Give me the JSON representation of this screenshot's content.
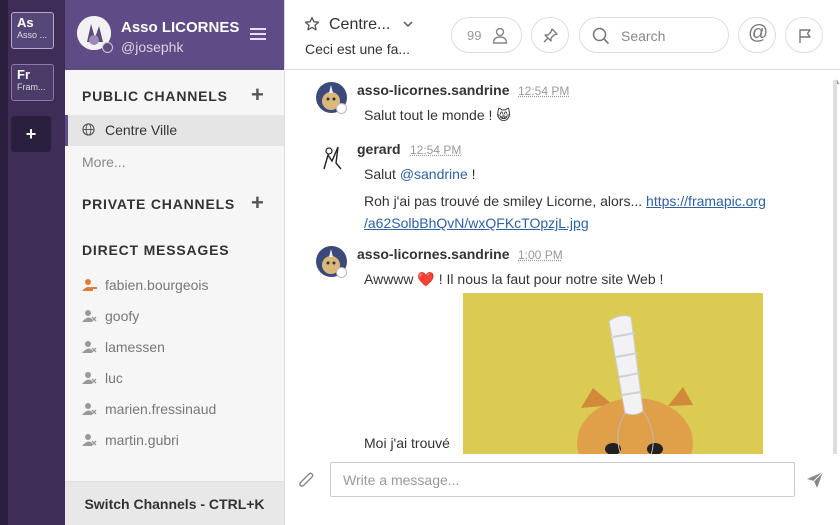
{
  "teams": [
    {
      "abbr": "As",
      "name": "Asso LICORNES",
      "sub": "Asso ..."
    },
    {
      "abbr": "Fr",
      "name": "Framasoft",
      "sub": "Fram..."
    }
  ],
  "add_team": "+",
  "sidebar": {
    "team_name": "Asso LICORNES",
    "username": "@josephk",
    "public_channels_title": "PUBLIC CHANNELS",
    "private_channels_title": "PRIVATE CHANNELS",
    "direct_messages_title": "DIRECT MESSAGES",
    "add_symbol": "+",
    "public_channels": [
      {
        "name": "Centre Ville",
        "active": true
      }
    ],
    "more_label": "More...",
    "direct_messages": [
      {
        "name": "fabien.bourgeois",
        "status": "away"
      },
      {
        "name": "goofy",
        "status": "offline"
      },
      {
        "name": "lamessen",
        "status": "offline"
      },
      {
        "name": "luc",
        "status": "offline"
      },
      {
        "name": "marien.fressinaud",
        "status": "offline"
      },
      {
        "name": "martin.gubri",
        "status": "offline"
      }
    ],
    "switch_channels": "Switch Channels - CTRL+K"
  },
  "header": {
    "channel_name": "Centre...",
    "purpose": "Ceci est une fa...",
    "member_count": "99",
    "search_placeholder": "Search",
    "mention_symbol": "@"
  },
  "posts": [
    {
      "author": "asso-licornes.sandrine",
      "time": "12:54 PM",
      "lines": [
        {
          "text": "Salut tout le monde ! 😸"
        }
      ]
    },
    {
      "author": "gerard",
      "time": "12:54 PM",
      "lines": [
        {
          "pre": "Salut ",
          "mention": "@sandrine",
          "post": " !"
        },
        {
          "pre": "Roh j'ai pas trouvé de smiley Licorne, alors... ",
          "link": "https://framapic.org"
        },
        {
          "link": "/a62SolbBhQvN/wxQFKcTOpzjL.jpg"
        }
      ]
    },
    {
      "author": "asso-licornes.sandrine",
      "time": "1:00 PM",
      "lines": [
        {
          "text": "Awwww ❤️ ! Il nous la faut pour notre site Web !"
        },
        {
          "text": "Moi j'ai trouvé"
        }
      ]
    }
  ],
  "composer": {
    "placeholder": "Write a message..."
  },
  "colors": {
    "sidebar_header": "#5f4c86",
    "team_bar": "#3d2d57",
    "link": "#2f61a3",
    "away": "#e07a3a"
  }
}
